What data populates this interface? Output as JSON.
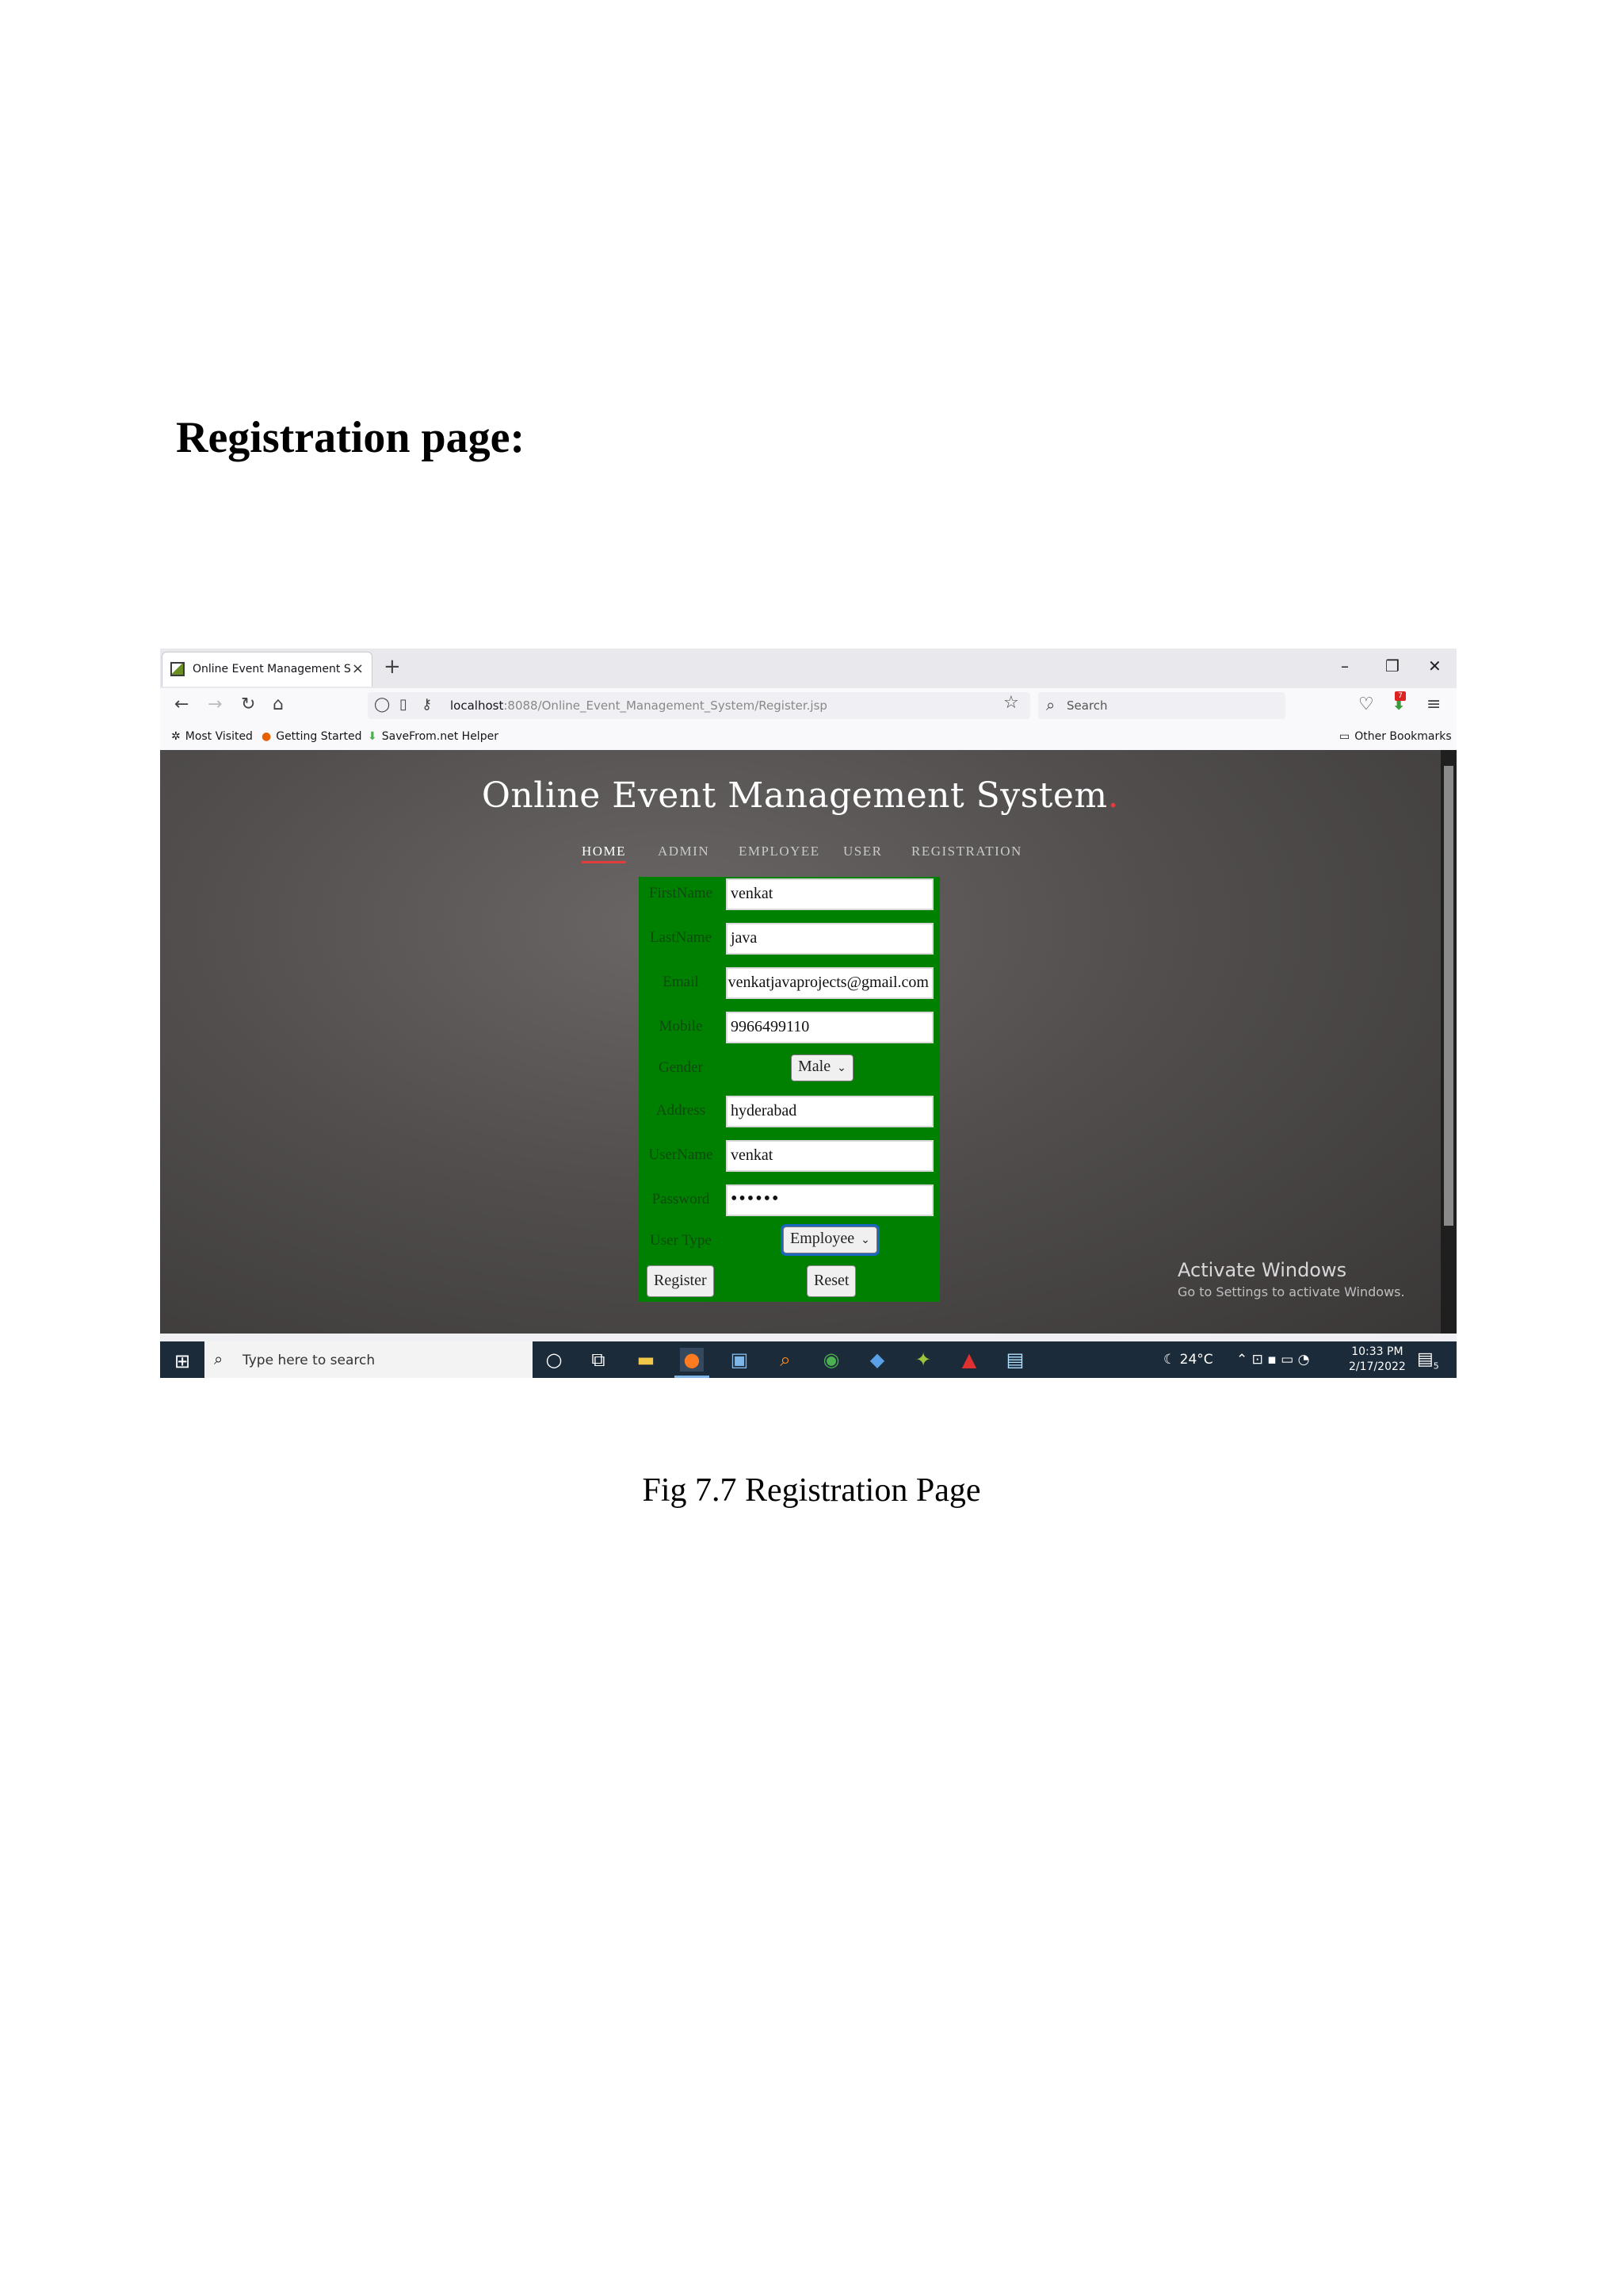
{
  "document": {
    "heading": "Registration page:",
    "caption": "Fig 7.7 Registration Page"
  },
  "browser": {
    "tab_title": "Online Event Management Syst",
    "tab_close": "×",
    "new_tab": "+",
    "window_controls": {
      "minimize": "–",
      "restore": "❐",
      "close": "✕"
    },
    "url_host": "localhost",
    "url_rest": ":8088/Online_Event_Management_System/Register.jsp",
    "search_placeholder": "Search",
    "bookmarks": [
      "Most Visited",
      "Getting Started",
      "SaveFrom.net Helper"
    ],
    "other_bookmarks": "Other Bookmarks",
    "extension_badge": "7"
  },
  "page": {
    "site_title": "Online Event Management System",
    "title_dot": ".",
    "menu": [
      "HOME",
      "ADMIN",
      "EMPLOYEE",
      "USER",
      "REGISTRATION"
    ],
    "active_menu": "HOME",
    "form": {
      "first_name": {
        "label": "FirstName",
        "value": "venkat"
      },
      "last_name": {
        "label": "LastName",
        "value": "java"
      },
      "email": {
        "label": "Email",
        "value": "venkatjavaprojects@gmail.com"
      },
      "mobile": {
        "label": "Mobile",
        "value": "9966499110"
      },
      "gender": {
        "label": "Gender",
        "value": "Male"
      },
      "address": {
        "label": "Address",
        "value": "hyderabad"
      },
      "user_name": {
        "label": "UserName",
        "value": "venkat"
      },
      "password": {
        "label": "Password",
        "value": "••••••"
      },
      "user_type": {
        "label": "User Type",
        "value": "Employee"
      },
      "register_label": "Register",
      "reset_label": "Reset"
    },
    "activate_windows": {
      "title": "Activate Windows",
      "subtitle": "Go to Settings to activate Windows."
    }
  },
  "taskbar": {
    "search_placeholder": "Type here to search",
    "temperature": "24°C",
    "time": "10:33 PM",
    "date": "2/17/2022",
    "notification_count": "5"
  },
  "colors": {
    "form_bg": "#008000",
    "menu_accent": "#e23c3c",
    "taskbar": "#1c2b3a"
  }
}
